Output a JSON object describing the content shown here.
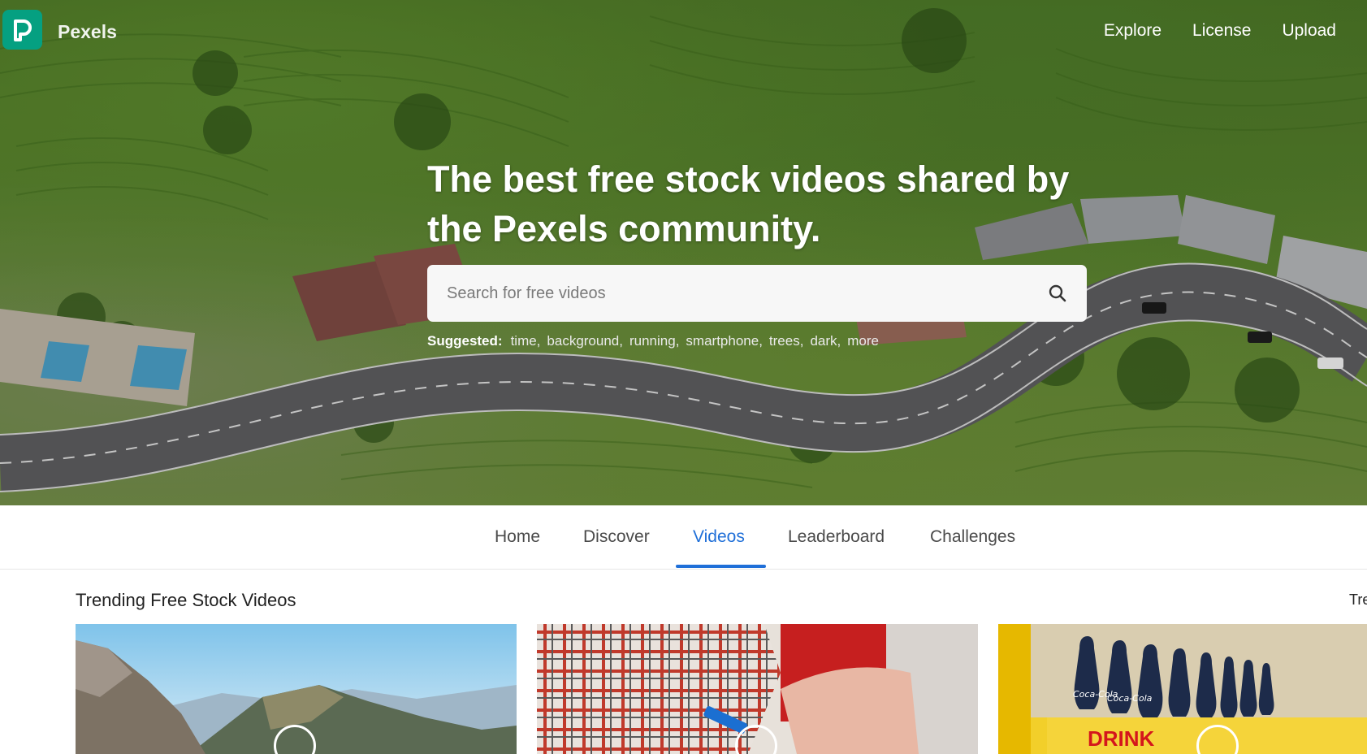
{
  "brand": {
    "name": "Pexels",
    "logo_letter": "P",
    "logo_color": "#05a081"
  },
  "topnav": {
    "items": [
      "Explore",
      "License",
      "Upload"
    ]
  },
  "hero": {
    "headline": "The best free stock videos shared by the Pexels community.",
    "search": {
      "placeholder": "Search for free videos",
      "value": ""
    },
    "suggested_label": "Suggested:",
    "suggested_tags": [
      "time,",
      "background,",
      "running,",
      "smartphone,",
      "trees,",
      "dark,",
      "more"
    ]
  },
  "tabs": {
    "items": [
      "Home",
      "Discover",
      "Videos",
      "Leaderboard",
      "Challenges"
    ],
    "active": "Videos",
    "active_color": "#1f6fd8"
  },
  "trending": {
    "title": "Trending Free Stock Videos",
    "more_label": "Tre",
    "cards": [
      {
        "subject": "mountain-landscape"
      },
      {
        "subject": "plaid-shirt-person"
      },
      {
        "subject": "coca-cola-bottles",
        "sign_text": "DRINK",
        "bottle_text": "Coca-Cola"
      }
    ]
  }
}
